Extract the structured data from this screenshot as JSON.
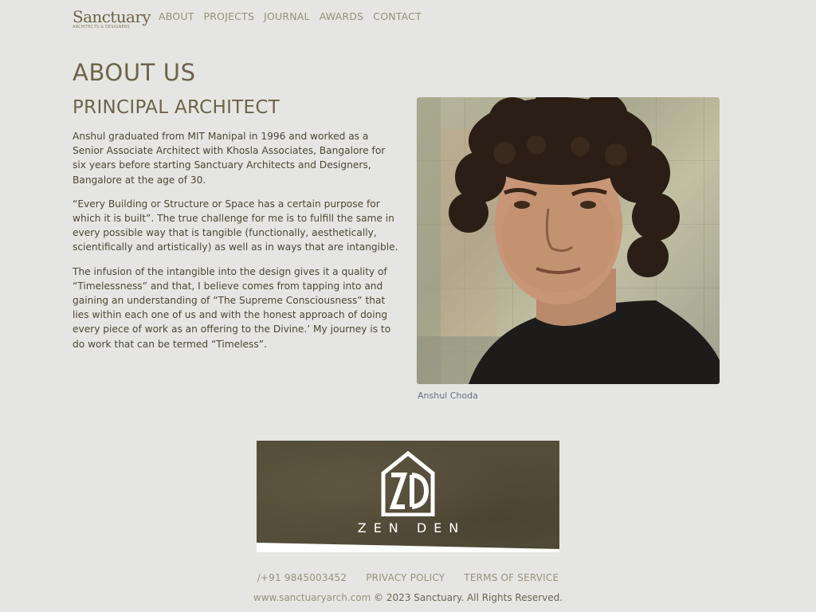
{
  "brand": {
    "logo_word": "Sanctuary",
    "logo_tagline": "ARCHITECTS & DESIGNERS"
  },
  "nav": {
    "about": "ABOUT",
    "projects": "PROJECTS",
    "journal": "JOURNAL",
    "awards": "AWARDS",
    "contact": "CONTACT"
  },
  "main": {
    "page_title": "ABOUT US",
    "section_title": "PRINCIPAL ARCHITECT",
    "paragraphs": [
      "Anshul graduated from MIT Manipal in 1996 and worked as a Senior Associate Architect with Khosla Associates, Bangalore for six years before starting Sanctuary Architects and Designers, Bangalore at the age of 30.",
      "“Every Building or Structure or Space has a certain purpose for which it is built”. The true challenge for me is to fulfill the same in every possible way that is tangible (functionally, aesthetically, scientifically and artistically) as well as in ways that are intangible.",
      "The infusion of the intangible into the design gives it a quality of “Timelessness” and that, I believe comes from tapping into and gaining an understanding of “The Supreme Consciousness” that lies within each one of us and with the honest approach of doing every piece of work as an offering to the Divine.’ My journey is to do work that can be termed “Timeless”."
    ],
    "portrait_caption": "Anshul Choda"
  },
  "banner": {
    "mark_text": "ZD",
    "text": "ZEN DEN"
  },
  "footer": {
    "phone": "/+91 9845003452",
    "privacy": "PRIVACY POLICY",
    "terms": "TERMS OF SERVICE",
    "website": "www.sanctuaryarch.com",
    "copyright": "© 2023 Sanctuary. All Rights Reserved."
  },
  "colors": {
    "background": "#e5e6e3",
    "body_text": "#4e4630",
    "heading": "#6e6347",
    "nav_link": "#9a8f72",
    "banner_bg": "#544d3a"
  }
}
